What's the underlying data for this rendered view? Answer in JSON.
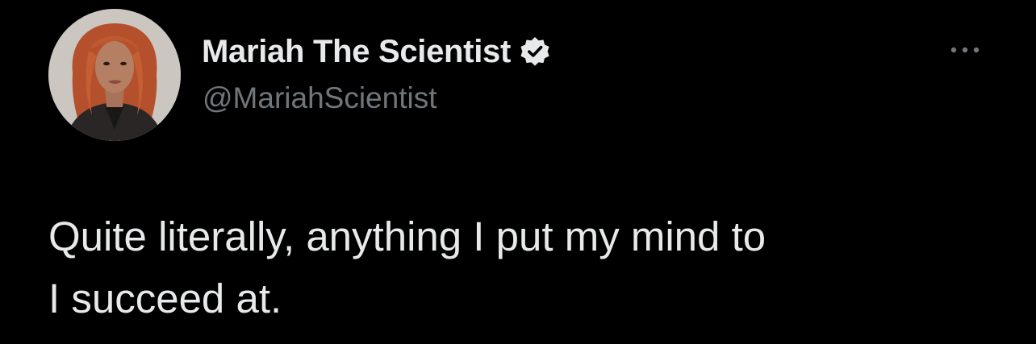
{
  "author": {
    "display_name": "Mariah The Scientist",
    "handle": "@MariahScientist",
    "verified": true,
    "avatar_icon": "profile-photo"
  },
  "tweet": {
    "text": "Quite literally, anything I put my mind to\nI succeed at."
  },
  "icons": {
    "verified": "verified-badge-icon",
    "more": "more-options-icon"
  },
  "colors": {
    "background": "#000000",
    "primary_text": "#e7e9ea",
    "secondary_text": "#71767b",
    "badge": "#e7e9ea"
  }
}
